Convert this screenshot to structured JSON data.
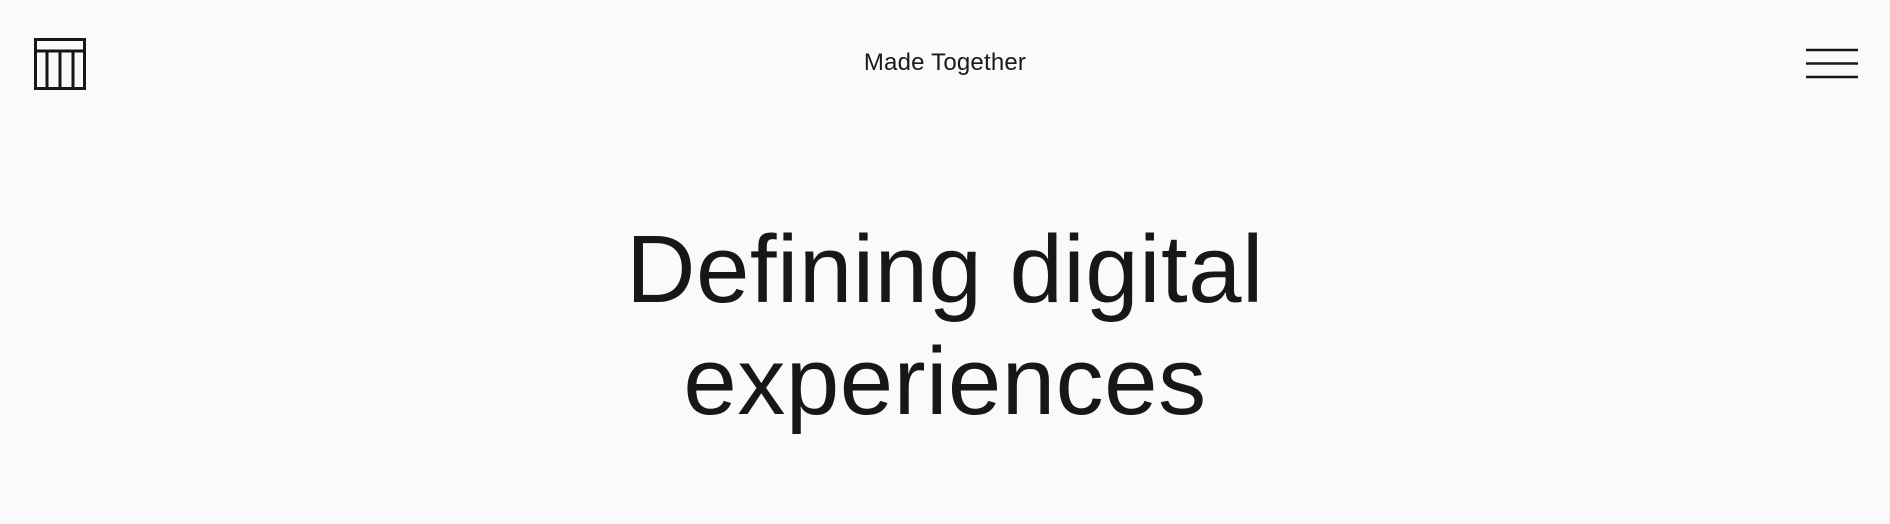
{
  "header": {
    "logo_icon": "tt-monogram-logo-icon",
    "site_title": "Made Together",
    "menu_icon": "hamburger-menu-icon"
  },
  "hero": {
    "headline_lines": [
      "Defining digital",
      "experiences"
    ]
  },
  "colors": {
    "background": "#fafafa",
    "text": "#171717"
  }
}
